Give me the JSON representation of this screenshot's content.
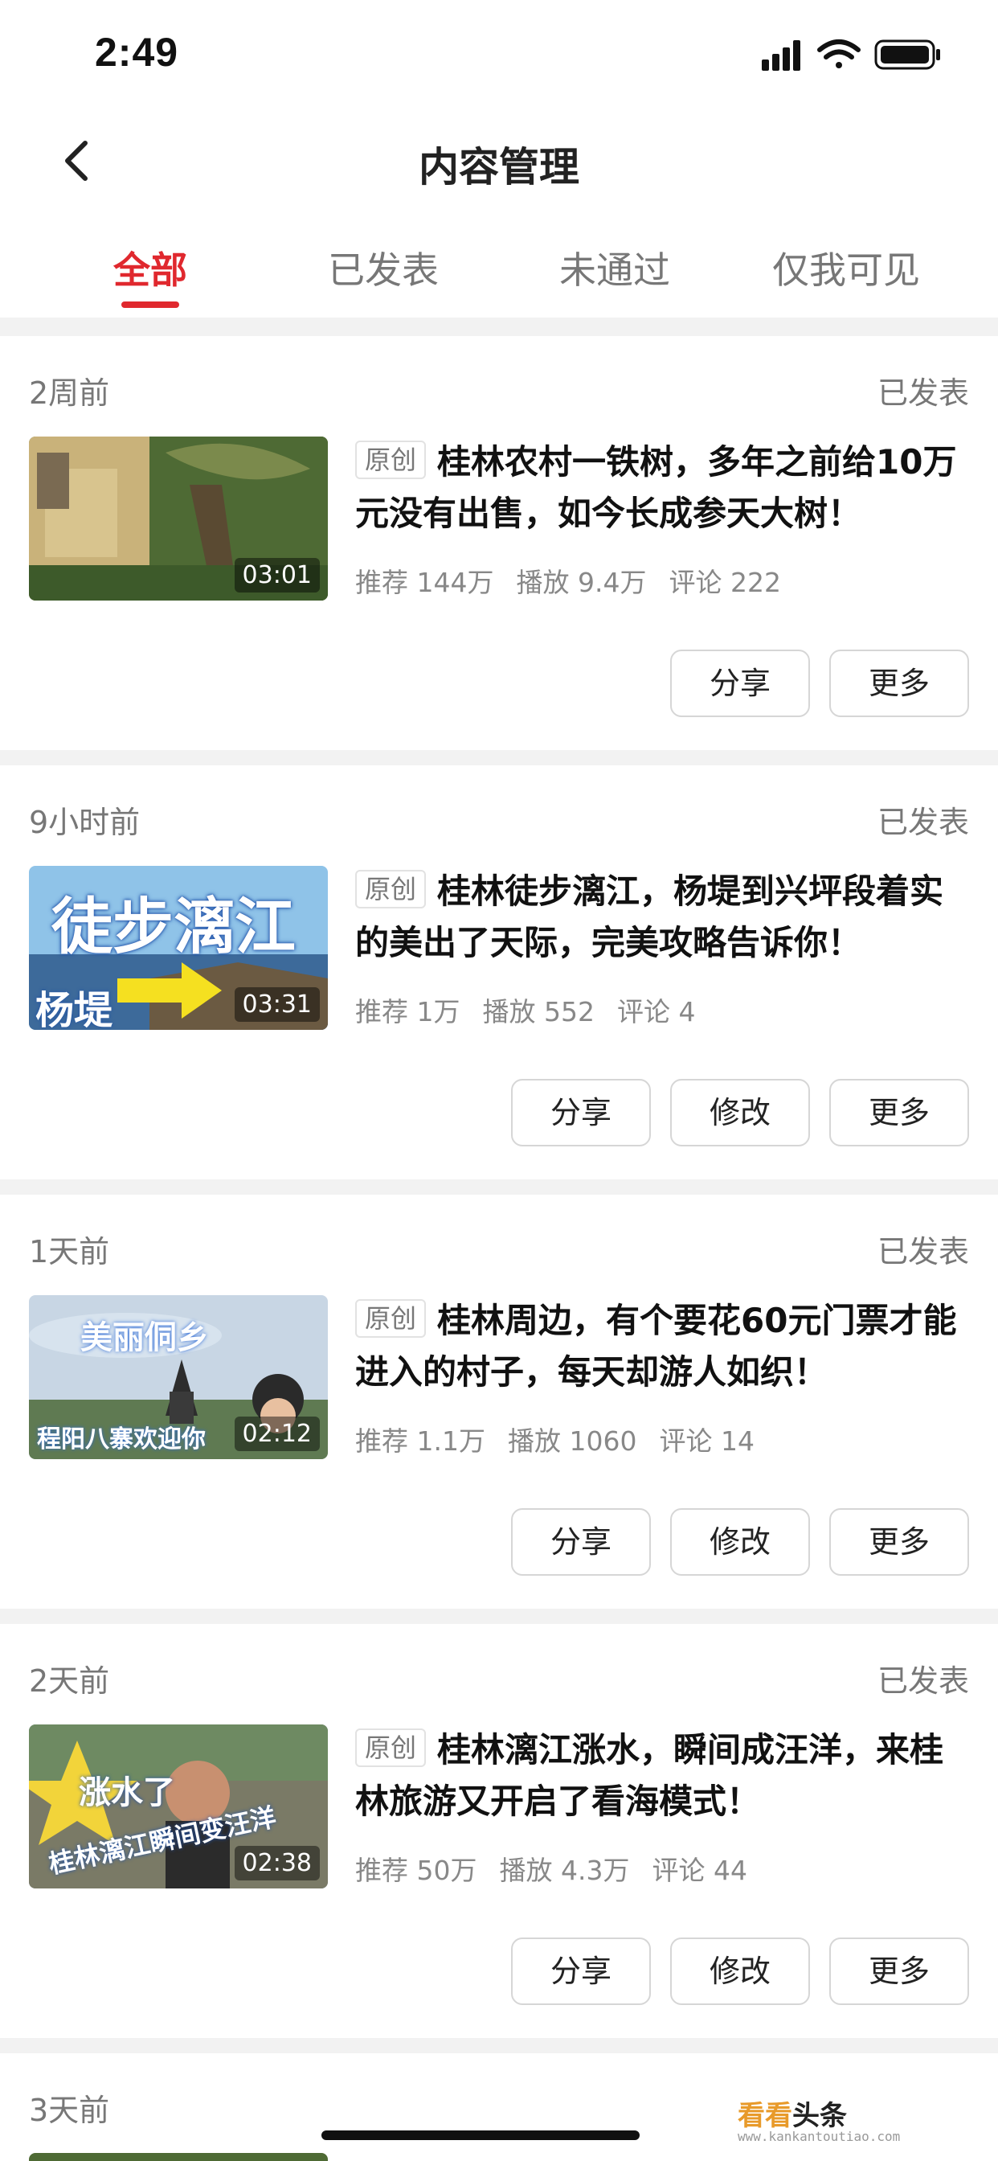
{
  "status_bar": {
    "time": "2:49"
  },
  "nav": {
    "title": "内容管理"
  },
  "tabs": [
    {
      "label": "全部",
      "active": true
    },
    {
      "label": "已发表",
      "active": false
    },
    {
      "label": "未通过",
      "active": false
    },
    {
      "label": "仅我可见",
      "active": false
    }
  ],
  "accent_color": "#e0282e",
  "cards": [
    {
      "date": "2周前",
      "status": "已发表",
      "tag": "原创",
      "title": "桂林农村一铁树，多年之前给10万元没有出售，如今长成参天大树！",
      "duration": "03:01",
      "stats": {
        "recommend": "推荐 144万",
        "plays": "播放 9.4万",
        "comments": "评论 222"
      },
      "buttons": [
        "分享",
        "更多"
      ]
    },
    {
      "date": "9小时前",
      "status": "已发表",
      "tag": "原创",
      "title": "桂林徒步漓江，杨堤到兴坪段着实的美出了天际，完美攻略告诉你！",
      "duration": "03:31",
      "thumb_text": {
        "main": "徒步漓江",
        "sub": "杨堤"
      },
      "stats": {
        "recommend": "推荐 1万",
        "plays": "播放 552",
        "comments": "评论 4"
      },
      "buttons": [
        "分享",
        "修改",
        "更多"
      ]
    },
    {
      "date": "1天前",
      "status": "已发表",
      "tag": "原创",
      "title": "桂林周边，有个要花60元门票才能进入的村子，每天却游人如织！",
      "duration": "02:12",
      "thumb_text": {
        "main": "美丽侗乡",
        "sub": "程阳八寨欢迎你"
      },
      "stats": {
        "recommend": "推荐 1.1万",
        "plays": "播放 1060",
        "comments": "评论 14"
      },
      "buttons": [
        "分享",
        "修改",
        "更多"
      ]
    },
    {
      "date": "2天前",
      "status": "已发表",
      "tag": "原创",
      "title": "桂林漓江涨水，瞬间成汪洋，来桂林旅游又开启了看海模式！",
      "duration": "02:38",
      "thumb_text": {
        "main": "涨水了",
        "sub": "桂林漓江瞬间变汪洋"
      },
      "stats": {
        "recommend": "推荐 50万",
        "plays": "播放 4.3万",
        "comments": "评论 44"
      },
      "buttons": [
        "分享",
        "修改",
        "更多"
      ]
    },
    {
      "date": "3天前"
    }
  ],
  "watermark": {
    "brand_a": "看看",
    "brand_b": "头条",
    "url": "www.kankantoutiao.com"
  }
}
